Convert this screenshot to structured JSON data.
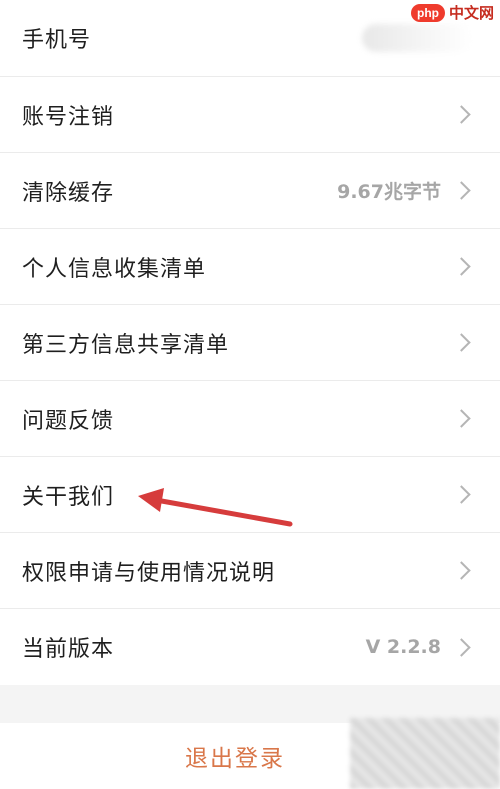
{
  "settings": {
    "rows": [
      {
        "label": "手机号",
        "value": ""
      },
      {
        "label": "账号注销",
        "value": ""
      },
      {
        "label": "清除缓存",
        "value": "9.67兆字节"
      },
      {
        "label": "个人信息收集清单",
        "value": ""
      },
      {
        "label": "第三方信息共享清单",
        "value": ""
      },
      {
        "label": "问题反馈",
        "value": ""
      },
      {
        "label": "关干我们",
        "value": ""
      },
      {
        "label": "权限申请与使用情况说明",
        "value": ""
      },
      {
        "label": "当前版本",
        "value": "V 2.2.8"
      }
    ],
    "logout_label": "退出登录"
  },
  "watermark": {
    "badge": "php",
    "text": "中文网"
  },
  "colors": {
    "logout": "#d9774a",
    "arrow": "#d63c3c",
    "watermark": "#ef3b2d"
  },
  "icons": {
    "row_chevron": "chevron-right-icon",
    "annotation": "red-arrow-icon"
  }
}
